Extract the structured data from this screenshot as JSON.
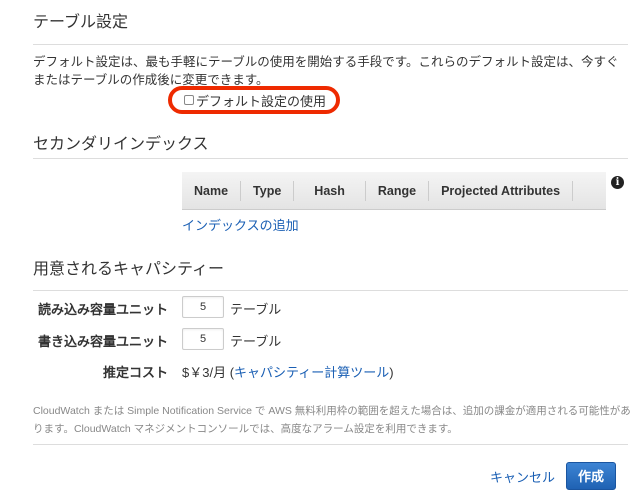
{
  "table_settings": {
    "title": "テーブル設定",
    "description": "デフォルト設定は、最も手軽にテーブルの使用を開始する手段です。これらのデフォルト設定は、今すぐまたはテーブルの作成後に変更できます。",
    "use_defaults_label": "デフォルト設定の使用",
    "use_defaults_checked": false
  },
  "secondary_index": {
    "title": "セカンダリインデックス",
    "columns": [
      "Name",
      "Type",
      "Hash",
      "Range",
      "Projected Attributes"
    ],
    "info_icon": "info-icon",
    "add_index_link": "インデックスの追加"
  },
  "capacity": {
    "title": "用意されるキャパシティー",
    "read_label": "読み込み容量ユニット",
    "read_value": "5",
    "read_unit": "テーブル",
    "write_label": "書き込み容量ユニット",
    "write_value": "5",
    "write_unit": "テーブル",
    "cost_label": "推定コスト",
    "cost_value": "$￥3/月",
    "cost_paren_open": "(",
    "calculator_link": "キャパシティー計算ツール",
    "cost_paren_close": ")"
  },
  "note": "CloudWatch または Simple Notification Service で AWS 無料利用枠の範囲を超えた場合は、追加の課金が適用される可能性があります。CloudWatch マネジメントコンソールでは、高度なアラーム設定を利用できます。",
  "footer": {
    "cancel": "キャンセル",
    "create": "作成"
  },
  "colors": {
    "accent": "#1f62b3",
    "highlight_ring": "#ee2a00"
  }
}
